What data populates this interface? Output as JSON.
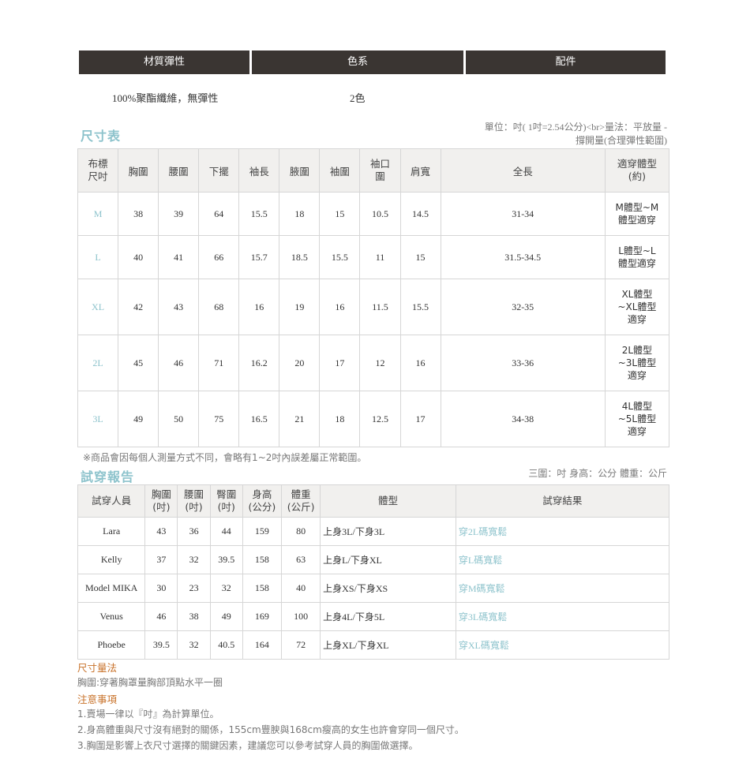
{
  "top_table": {
    "headers": [
      "材質彈性",
      "色系",
      "配件"
    ],
    "material": "100%聚酯纖維，無彈性",
    "color": "2色"
  },
  "size_chart": {
    "title": "尺寸表",
    "unit_note_line1": "單位：吋( 1吋=2.54公分)<br>量法：平放量 -",
    "unit_note_line2": "撐開量(合理彈性範圍)",
    "headers": [
      "布標尺吋",
      "胸圍",
      "腰圍",
      "下擺",
      "袖長",
      "腋圍",
      "袖圍",
      "袖口圍",
      "肩寬",
      "全長",
      "適穿體型(約)"
    ],
    "rows": [
      {
        "size": "M",
        "values": [
          "38",
          "39",
          "64",
          "15.5",
          "18",
          "15",
          "10.5",
          "14.5",
          "31-34"
        ],
        "fit": "M體型~M體型適穿"
      },
      {
        "size": "L",
        "values": [
          "40",
          "41",
          "66",
          "15.7",
          "18.5",
          "15.5",
          "11",
          "15",
          "31.5-34.5"
        ],
        "fit": "L體型~L體型適穿"
      },
      {
        "size": "XL",
        "values": [
          "42",
          "43",
          "68",
          "16",
          "19",
          "16",
          "11.5",
          "15.5",
          "32-35"
        ],
        "fit": "XL體型~XL體型適穿"
      },
      {
        "size": "2L",
        "values": [
          "45",
          "46",
          "71",
          "16.2",
          "20",
          "17",
          "12",
          "16",
          "33-36"
        ],
        "fit": "2L體型~3L體型適穿"
      },
      {
        "size": "3L",
        "values": [
          "49",
          "50",
          "75",
          "16.5",
          "21",
          "18",
          "12.5",
          "17",
          "34-38"
        ],
        "fit": "4L體型~5L體型適穿"
      }
    ],
    "remark": "※商品會因每個人測量方式不同，會略有1~2吋內誤差屬正常範圍。"
  },
  "try_report": {
    "title": "試穿報告",
    "unit_note": "三圍：吋 身高：公分 體重：公斤",
    "headers": [
      "試穿人員",
      "胸圍(吋)",
      "腰圍(吋)",
      "臀圍(吋)",
      "身高(公分)",
      "體重(公斤)",
      "體型",
      "試穿結果"
    ],
    "rows": [
      {
        "name": "Lara",
        "bust": "43",
        "waist": "36",
        "hip": "44",
        "height": "159",
        "weight": "80",
        "body": "上身3L/下身3L",
        "result": "穿2L碼寬鬆"
      },
      {
        "name": "Kelly",
        "bust": "37",
        "waist": "32",
        "hip": "39.5",
        "height": "158",
        "weight": "63",
        "body": "上身L/下身XL",
        "result": "穿L碼寬鬆"
      },
      {
        "name": "Model MIKA",
        "bust": "30",
        "waist": "23",
        "hip": "32",
        "height": "158",
        "weight": "40",
        "body": "上身XS/下身XS",
        "result": "穿M碼寬鬆"
      },
      {
        "name": "Venus",
        "bust": "46",
        "waist": "38",
        "hip": "49",
        "height": "169",
        "weight": "100",
        "body": "上身4L/下身5L",
        "result": "穿3L碼寬鬆"
      },
      {
        "name": "Phoebe",
        "bust": "39.5",
        "waist": "32",
        "hip": "40.5",
        "height": "164",
        "weight": "72",
        "body": "上身XL/下身XL",
        "result": "穿XL碼寬鬆"
      }
    ]
  },
  "measure_method": {
    "title": "尺寸量法",
    "text": "胸圍:穿著胸罩量胸部頂點水平一圈"
  },
  "notes": {
    "title": "注意事項",
    "items": [
      "1.賣場一律以『吋』為計算單位。",
      "2.身高體重與尺寸沒有絕對的關係，155cm豐腴與168cm瘦高的女生也許會穿同一個尺寸。",
      "3.胸圍是影響上衣尺寸選擇的關鍵因素，建議您可以參考試穿人員的胸圍做選擇。"
    ]
  }
}
